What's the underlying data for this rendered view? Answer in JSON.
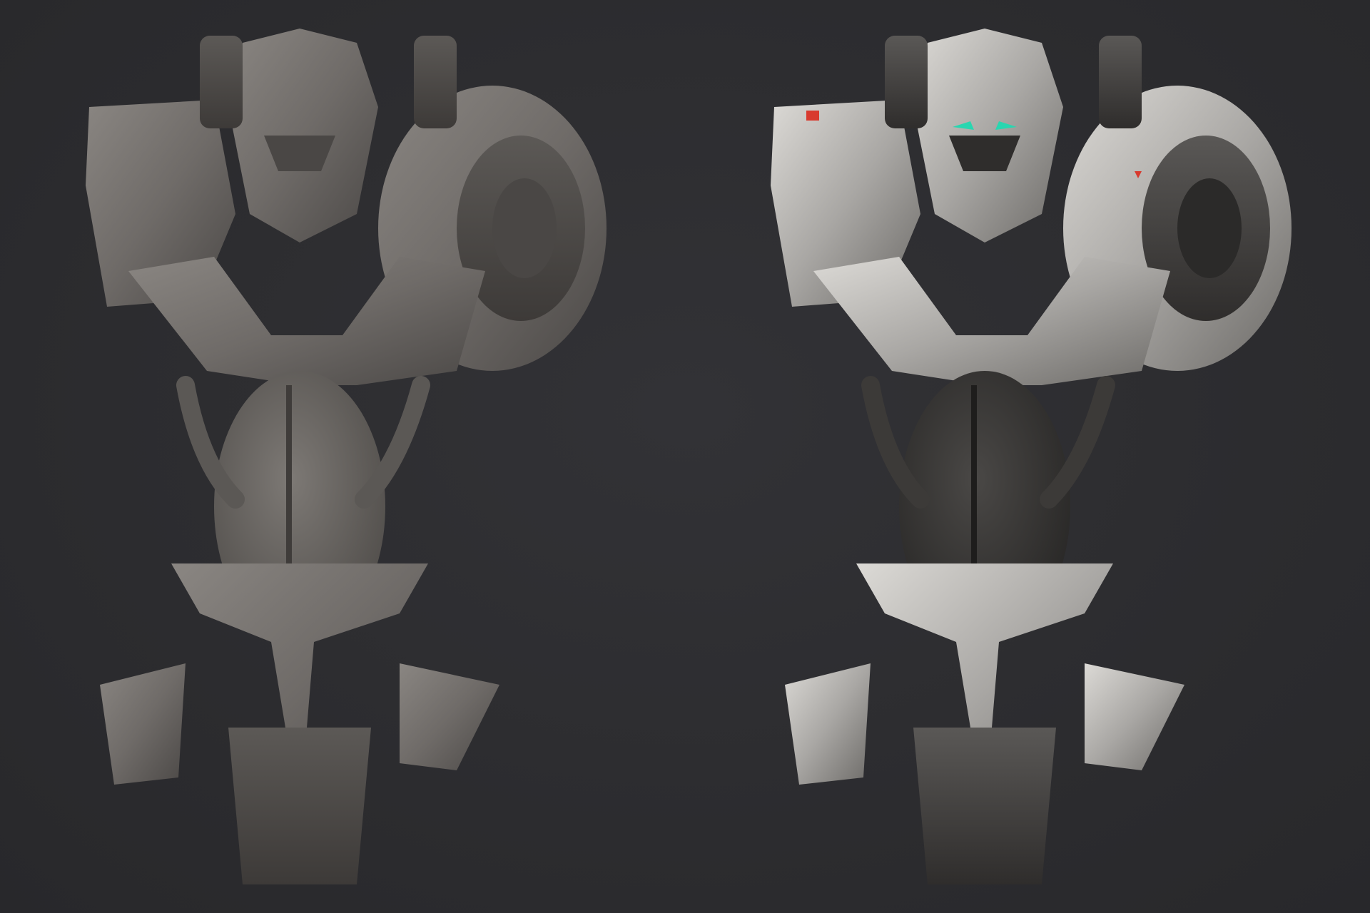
{
  "scene": {
    "background_color": "#2d2d30",
    "renders": [
      {
        "id": "clay",
        "description_shading": "untextured-clay",
        "base_color": "#6f6b68",
        "shadow_color": "#3f3c3a",
        "highlight_color": "#8c8884"
      },
      {
        "id": "textured",
        "description_shading": "painted-metal",
        "base_color": "#a9a7a4",
        "shadow_color": "#3a3836",
        "highlight_color": "#d6d4d0",
        "accent_eye_color": "#29d6b0",
        "decal_color": "#d83a2e"
      }
    ]
  }
}
